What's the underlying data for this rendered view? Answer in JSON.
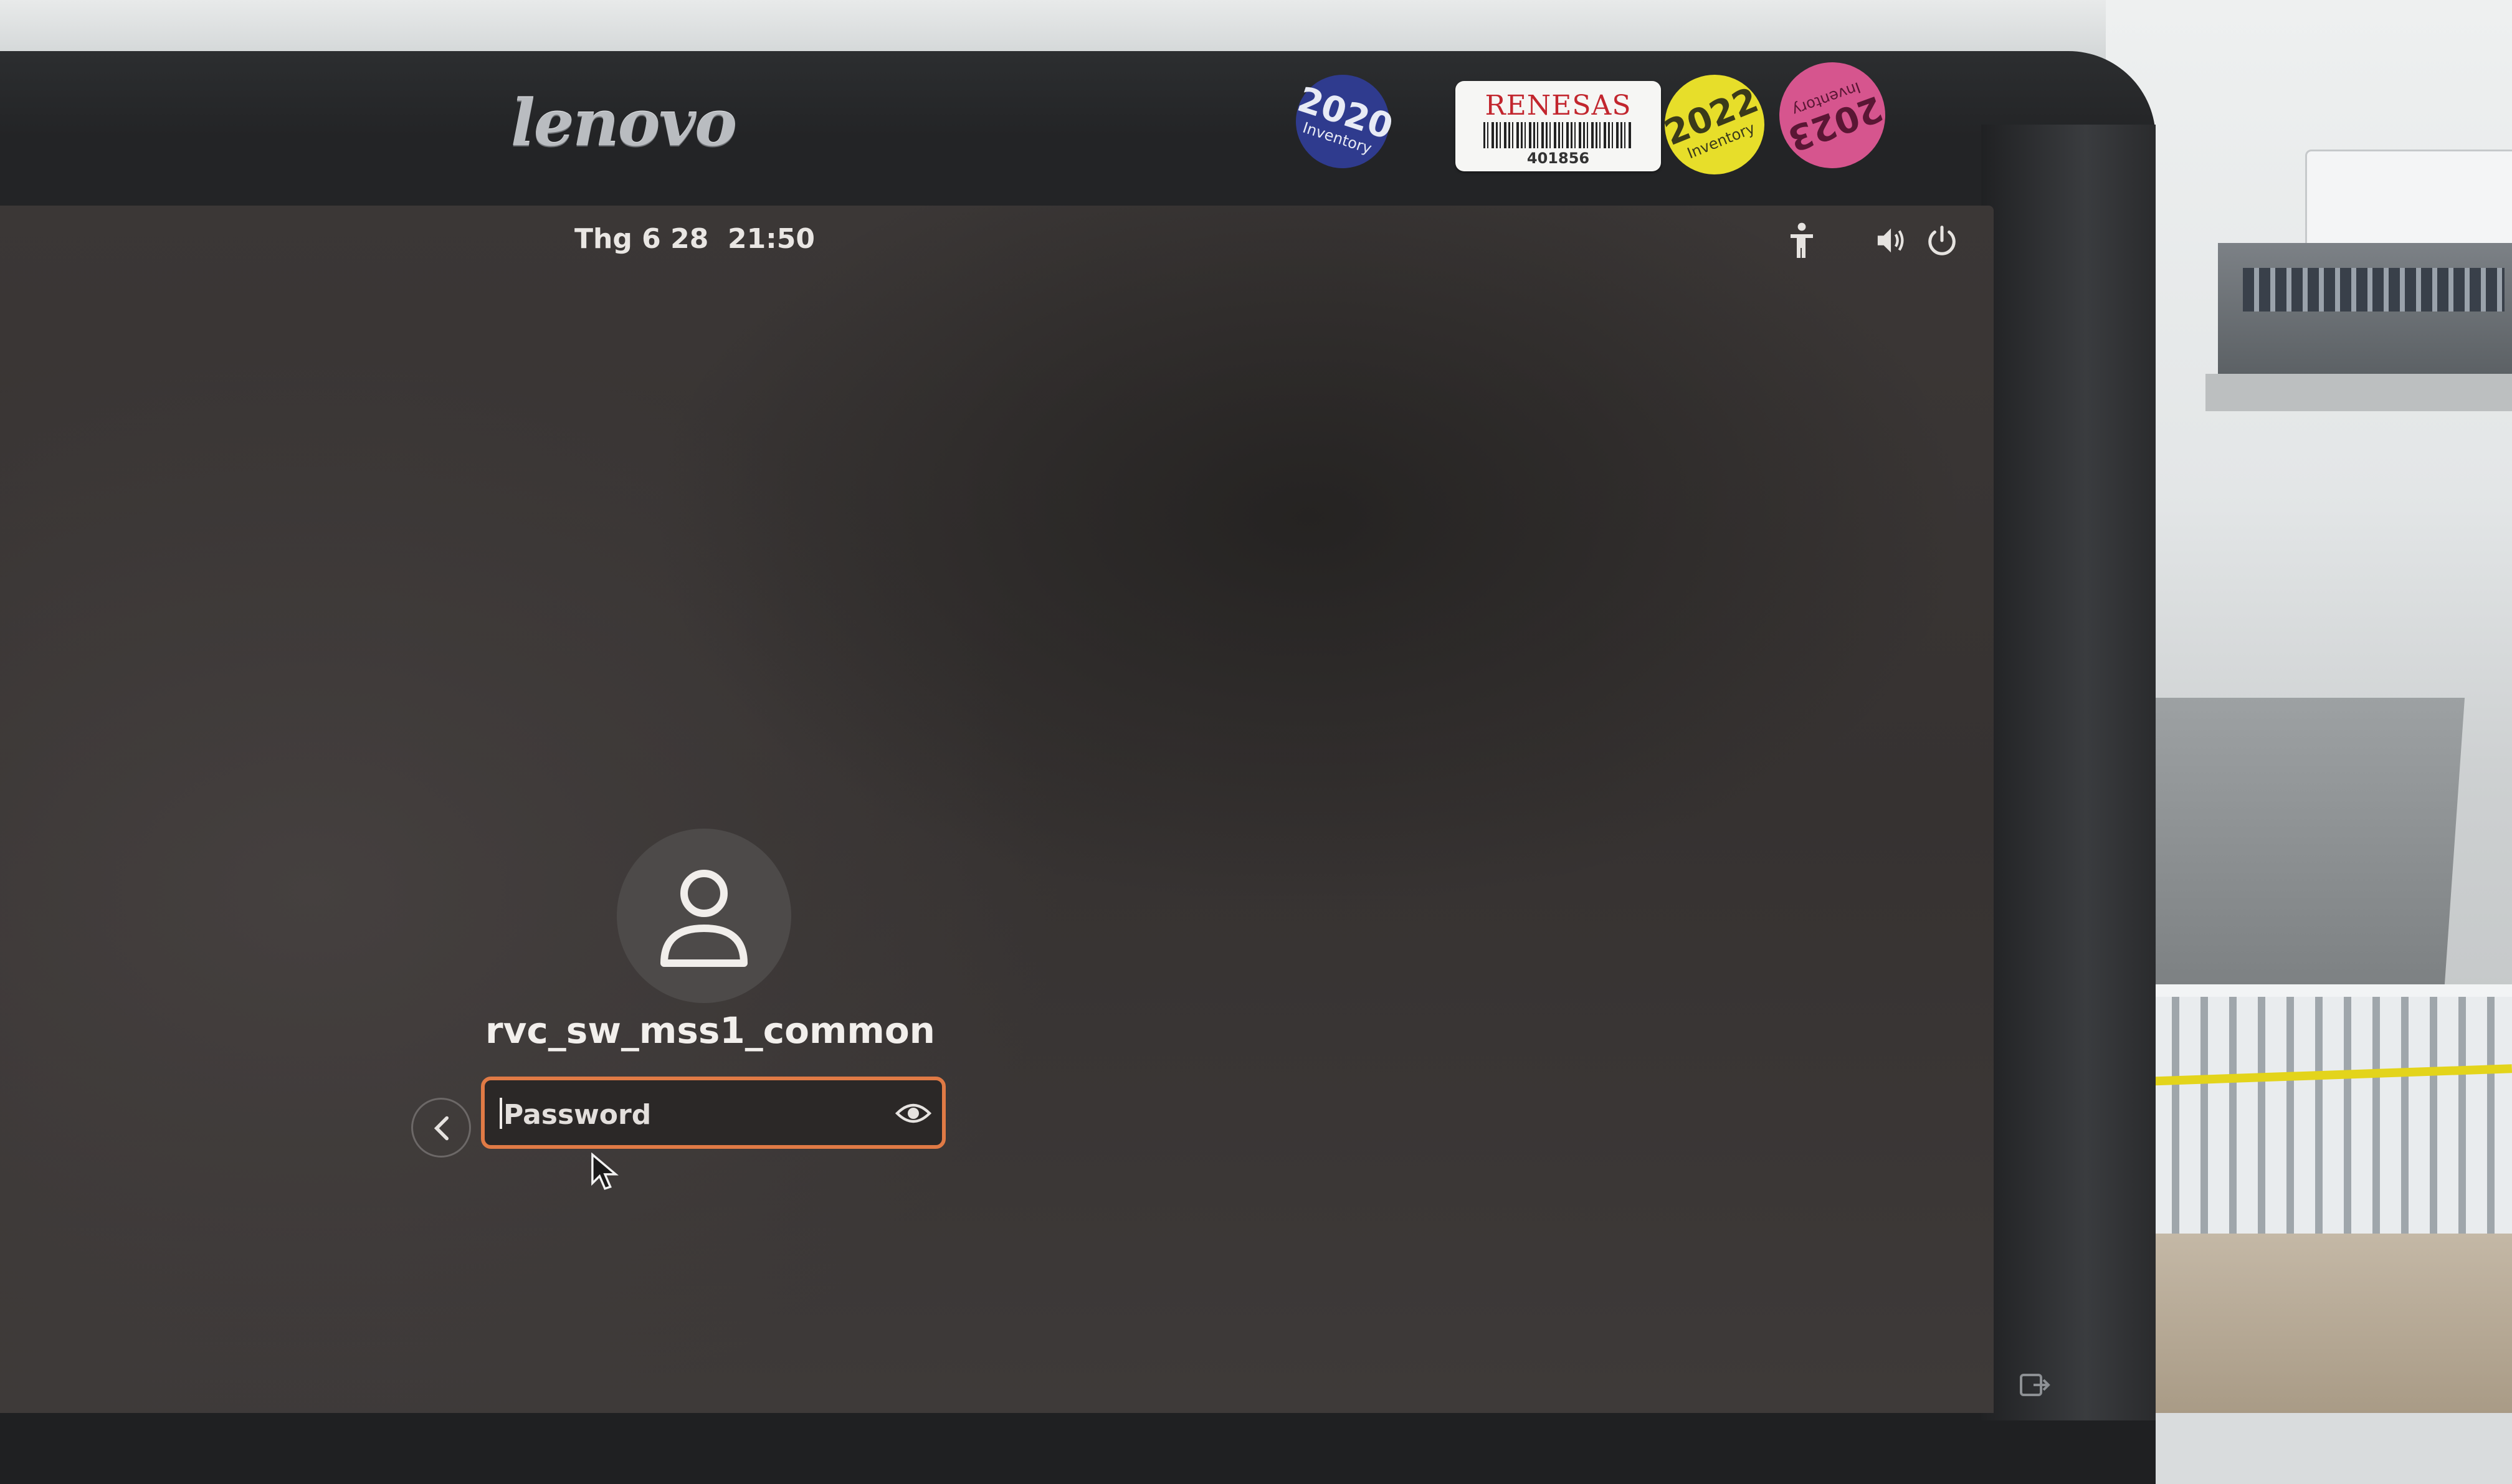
{
  "monitor": {
    "brand_logo": "lenovo",
    "stickers": {
      "inventory_2020": {
        "year": "2020",
        "caption": "Inventory"
      },
      "inventory_2022": {
        "year": "2022",
        "caption": "Inventory"
      },
      "inventory_2023": {
        "year": "2023",
        "caption": "Inventory"
      }
    },
    "asset_label": {
      "brand": "RENESAS",
      "number": "401856"
    }
  },
  "top_bar": {
    "clock": "Thg 6 28  21:50",
    "icons": [
      "accessibility-icon",
      "volume-icon",
      "power-icon"
    ]
  },
  "login": {
    "avatar_icon": "user-avatar-icon",
    "username": "rvc_sw_mss1_common",
    "password_placeholder": "Password",
    "reveal_icon": "eye-icon",
    "back_icon": "chevron-left-icon"
  },
  "colors": {
    "accent": "#e07a45",
    "screen_bg": "#383433",
    "text": "#f2efec"
  }
}
